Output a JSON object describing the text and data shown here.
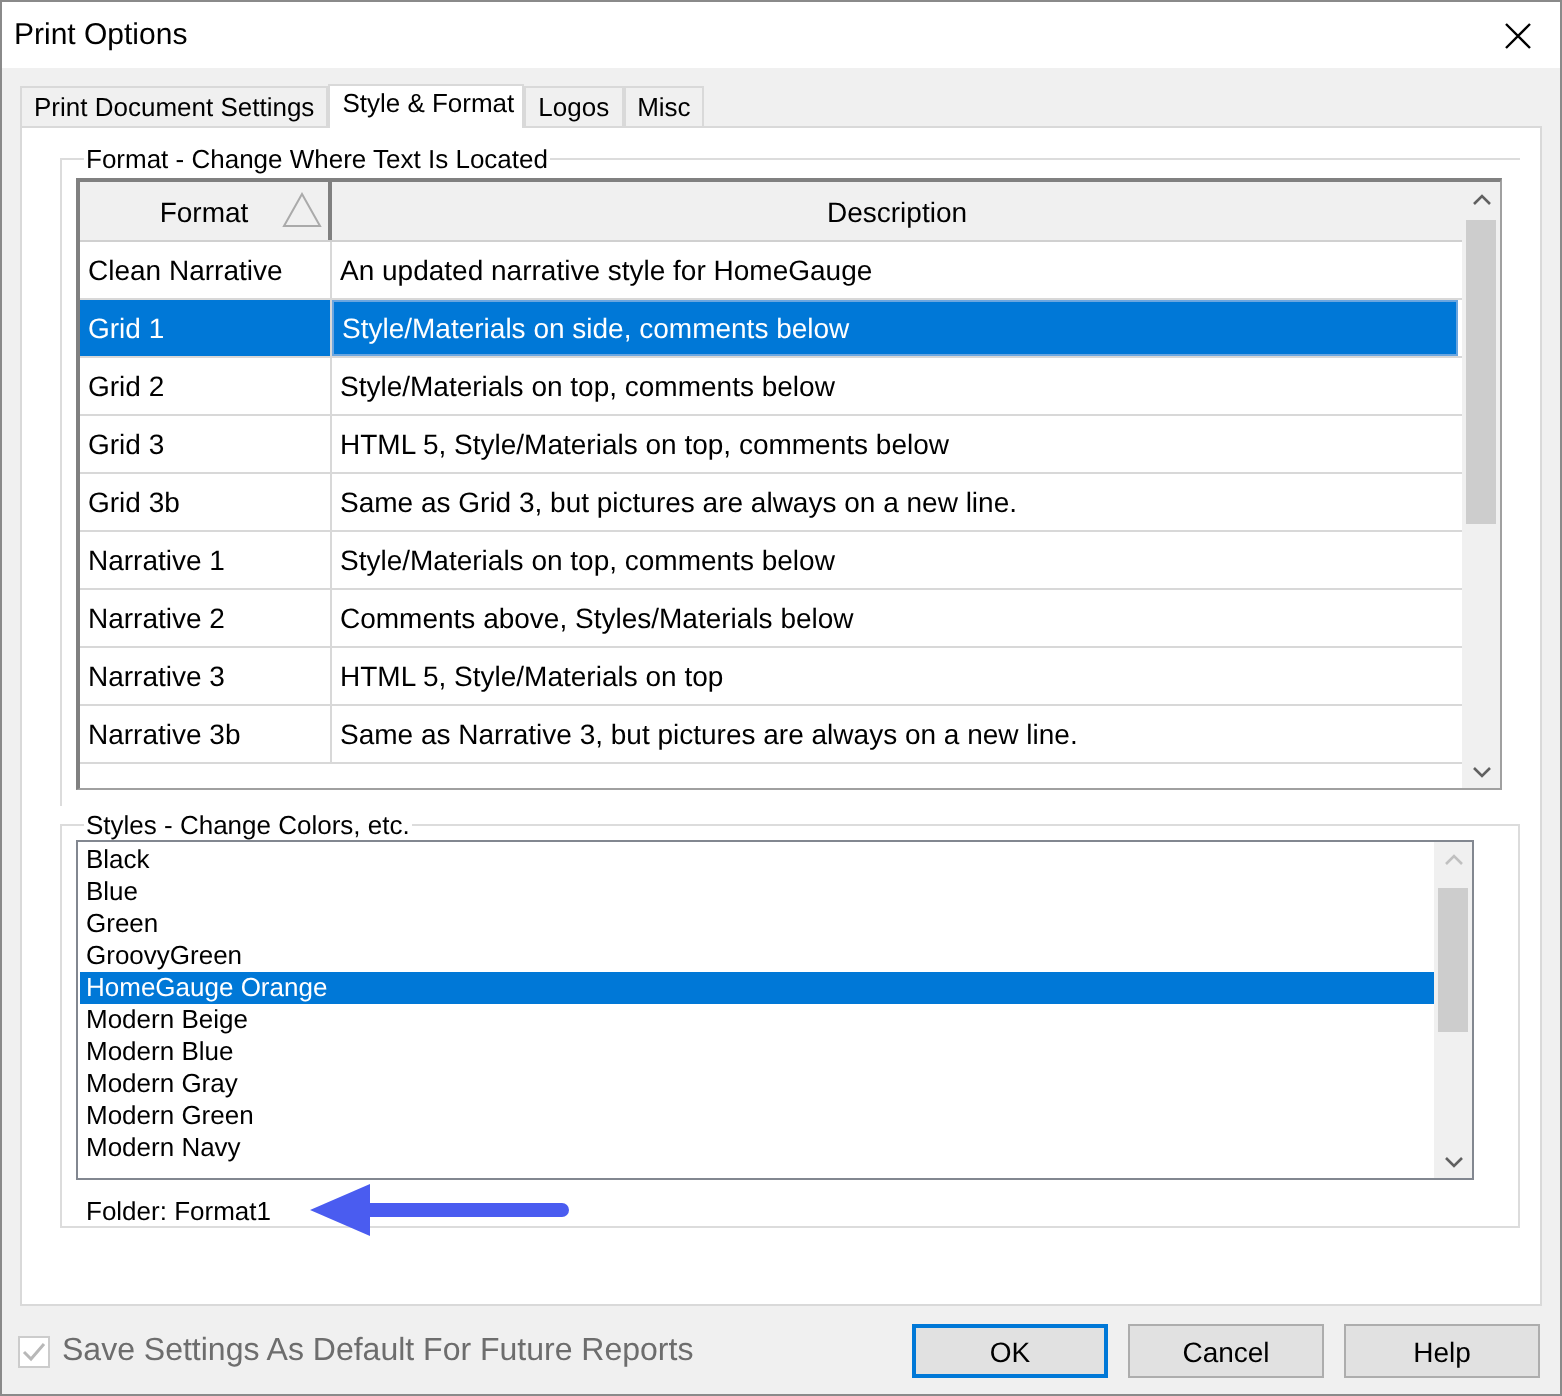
{
  "window": {
    "title": "Print Options"
  },
  "tabs": [
    {
      "label": "Print Document Settings",
      "selected": false
    },
    {
      "label": "Style & Format",
      "selected": true
    },
    {
      "label": "Logos",
      "selected": false
    },
    {
      "label": "Misc",
      "selected": false
    }
  ],
  "format_group": {
    "title": "Format - Change Where Text Is Located",
    "columns": [
      "Format",
      "Description"
    ],
    "rows": [
      {
        "format": "Clean Narrative",
        "description": "An updated narrative style for HomeGauge",
        "selected": false
      },
      {
        "format": "Grid 1",
        "description": "Style/Materials on side, comments below",
        "selected": true
      },
      {
        "format": "Grid 2",
        "description": "Style/Materials on top, comments below",
        "selected": false
      },
      {
        "format": "Grid 3",
        "description": "HTML 5, Style/Materials on top, comments below",
        "selected": false
      },
      {
        "format": "Grid 3b",
        "description": "Same as Grid 3, but pictures are always on a new line.",
        "selected": false
      },
      {
        "format": "Narrative 1",
        "description": "Style/Materials on top, comments below",
        "selected": false
      },
      {
        "format": "Narrative 2",
        "description": "Comments above, Styles/Materials below",
        "selected": false
      },
      {
        "format": "Narrative 3",
        "description": "HTML 5, Style/Materials on top",
        "selected": false
      },
      {
        "format": "Narrative 3b",
        "description": "Same as Narrative 3, but pictures are always on a new line.",
        "selected": false
      }
    ]
  },
  "styles_group": {
    "title": "Styles - Change Colors, etc.",
    "items": [
      {
        "label": "Black",
        "selected": false
      },
      {
        "label": "Blue",
        "selected": false
      },
      {
        "label": "Green",
        "selected": false
      },
      {
        "label": "GroovyGreen",
        "selected": false
      },
      {
        "label": "HomeGauge Orange",
        "selected": true
      },
      {
        "label": "Modern Beige",
        "selected": false
      },
      {
        "label": "Modern Blue",
        "selected": false
      },
      {
        "label": "Modern Gray",
        "selected": false
      },
      {
        "label": "Modern Green",
        "selected": false
      },
      {
        "label": "Modern Navy",
        "selected": false
      }
    ],
    "folder": "Folder: Format1"
  },
  "save_default": {
    "label": "Save Settings As Default For Future Reports",
    "checked": true,
    "disabled": true
  },
  "buttons": [
    {
      "label": "OK",
      "focused": true
    },
    {
      "label": "Cancel",
      "focused": false
    },
    {
      "label": "Help",
      "focused": false
    }
  ]
}
